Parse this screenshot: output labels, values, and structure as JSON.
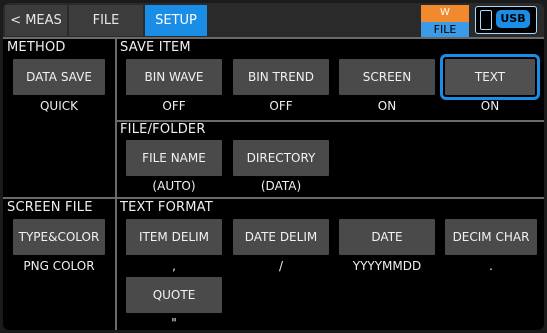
{
  "tabs": {
    "meas": "< MEAS",
    "file": "FILE",
    "setup": "SETUP"
  },
  "status": {
    "w_label": "W",
    "file_label": "FILE",
    "usb_label": "USB"
  },
  "method": {
    "header": "METHOD",
    "button": "DATA SAVE",
    "value": "QUICK"
  },
  "save_item": {
    "header": "SAVE ITEM",
    "items": [
      {
        "label": "BIN WAVE",
        "value": "OFF"
      },
      {
        "label": "BIN TREND",
        "value": "OFF"
      },
      {
        "label": "SCREEN",
        "value": "ON"
      },
      {
        "label": "TEXT",
        "value": "ON",
        "selected": true
      }
    ]
  },
  "file_folder": {
    "header": "FILE/FOLDER",
    "items": [
      {
        "label": "FILE NAME",
        "value": "(AUTO)"
      },
      {
        "label": "DIRECTORY",
        "value": "(DATA)"
      }
    ]
  },
  "screen_file": {
    "header": "SCREEN FILE",
    "button": "TYPE&COLOR",
    "value": "PNG COLOR"
  },
  "text_format": {
    "header": "TEXT FORMAT",
    "items": [
      {
        "label": "ITEM DELIM",
        "value": ","
      },
      {
        "label": "DATE DELIM",
        "value": "/"
      },
      {
        "label": "DATE",
        "value": "YYYYMMDD"
      },
      {
        "label": "DECIM CHAR",
        "value": "."
      },
      {
        "label": "QUOTE",
        "value": "\""
      }
    ]
  }
}
